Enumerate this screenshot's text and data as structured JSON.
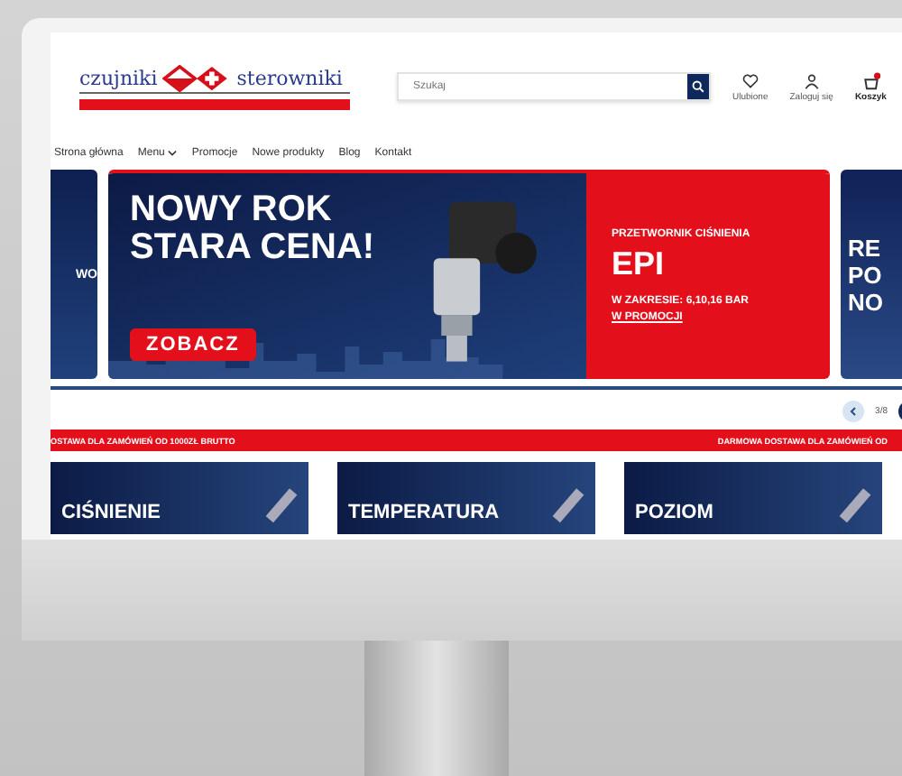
{
  "logo": {
    "left": "czujniki",
    "right": "sterowniki"
  },
  "search": {
    "placeholder": "Szukaj"
  },
  "header_actions": [
    {
      "kind": "heart",
      "label": "Ulubione"
    },
    {
      "kind": "user",
      "label": "Zaloguj się"
    },
    {
      "kind": "cart",
      "label": "Koszyk"
    }
  ],
  "nav": [
    {
      "label": "Strona główna",
      "dropdown": false
    },
    {
      "label": "Menu",
      "dropdown": true
    },
    {
      "label": "Promocje",
      "dropdown": false
    },
    {
      "label": "Nowe produkty",
      "dropdown": false
    },
    {
      "label": "Blog",
      "dropdown": false
    },
    {
      "label": "Kontakt",
      "dropdown": false
    }
  ],
  "banners": {
    "left_partial": "WO",
    "main": {
      "title": [
        "NOWY ROK",
        "STARA CENA!"
      ],
      "button": "ZOBACZ",
      "kicker": "PRZETWORNIK CIŚNIENIA",
      "product": "EPI",
      "range": "W ZAKRESIE: 6,10,16 BAR",
      "link": "W PROMOCJI"
    },
    "right_partial": [
      "RE",
      "PO",
      "NO"
    ]
  },
  "pagination": "3/8",
  "ticker": [
    "OSTAWA DLA ZAMÓWIEŃ OD 1000ZŁ BRUTTO",
    "DARMOWA DOSTAWA DLA ZAMÓWIEŃ OD"
  ],
  "categories": [
    "CIŚNIENIE",
    "TEMPERATURA",
    "POZIOM"
  ]
}
